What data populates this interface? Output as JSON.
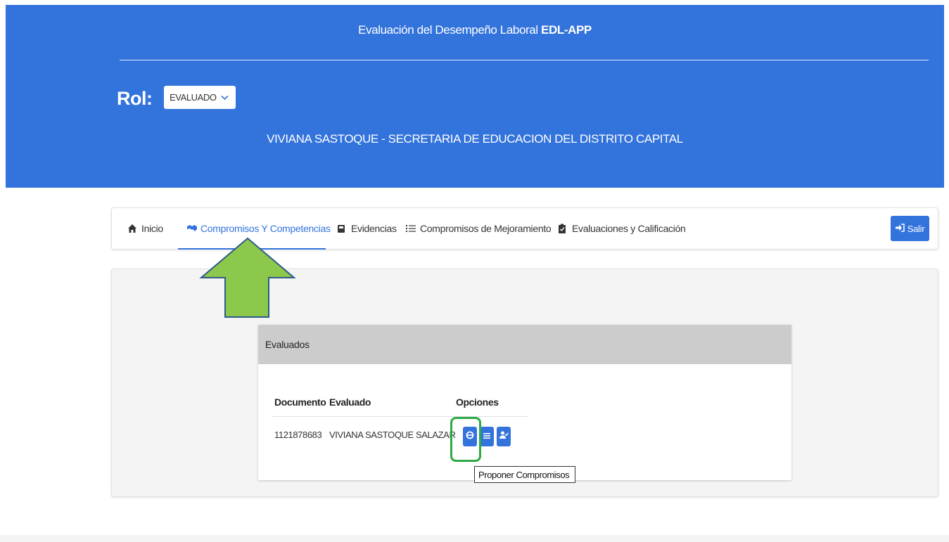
{
  "header": {
    "title_prefix": "Evaluación del Desempeño Laboral ",
    "title_bold": "EDL-APP",
    "rol_label": "Rol:",
    "rol_value": "EVALUADO",
    "user_line": "VIVIANA SASTOQUE - SECRETARIA DE EDUCACION DEL DISTRITO CAPITAL"
  },
  "nav": {
    "items": [
      {
        "label": "Inicio",
        "icon": "home-icon"
      },
      {
        "label": "Compromisos Y Competencias",
        "icon": "handshake-icon",
        "active": true
      },
      {
        "label": "Evidencias",
        "icon": "lock-icon"
      },
      {
        "label": "Compromisos de Mejoramiento",
        "icon": "list-icon"
      },
      {
        "label": "Evaluaciones y Calificación",
        "icon": "clipboard-icon"
      }
    ],
    "logout_label": "Salir"
  },
  "panel": {
    "title": "Evaluados",
    "columns": [
      "Documento",
      "Evaluado",
      "Opciones"
    ],
    "rows": [
      {
        "documento": "1121878683",
        "evaluado": "VIVIANA SASTOQUE SALAZAR"
      }
    ],
    "tooltip": "Proponer Compromisos"
  },
  "colors": {
    "primary": "#3373dc",
    "highlight": "#2eaa44",
    "arrow_fill": "#8cc84b",
    "arrow_stroke": "#2d5a8a"
  }
}
